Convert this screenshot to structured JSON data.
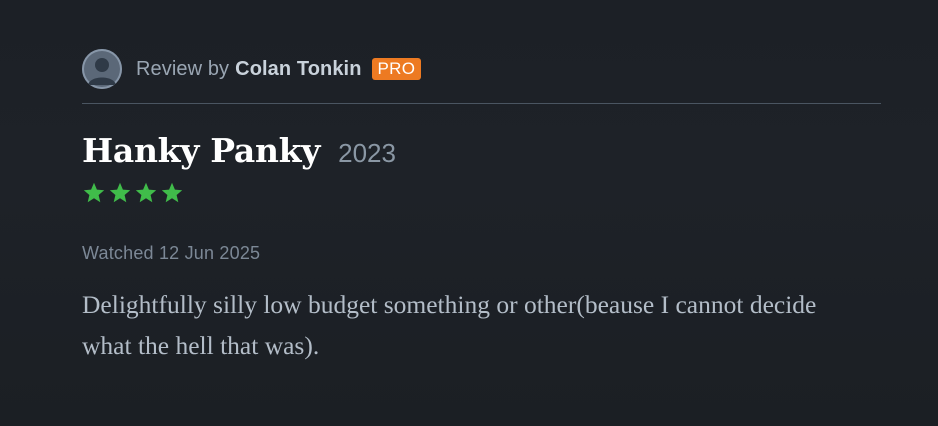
{
  "review": {
    "byline_prefix": "Review by",
    "reviewer_name": "Colan Tonkin",
    "badge": "PRO",
    "film_title": "Hanky Panky",
    "film_year": "2023",
    "rating_stars": 4,
    "watched_date": "Watched 12 Jun 2025",
    "body": "Delightfully silly low budget something or other(beause I cannot decide what the hell that was)."
  },
  "colors": {
    "background": "#1c2026",
    "star": "#40bc4a",
    "badge": "#ed7a22"
  },
  "icons": {
    "avatar": "user-avatar-icon",
    "star": "star-icon"
  }
}
